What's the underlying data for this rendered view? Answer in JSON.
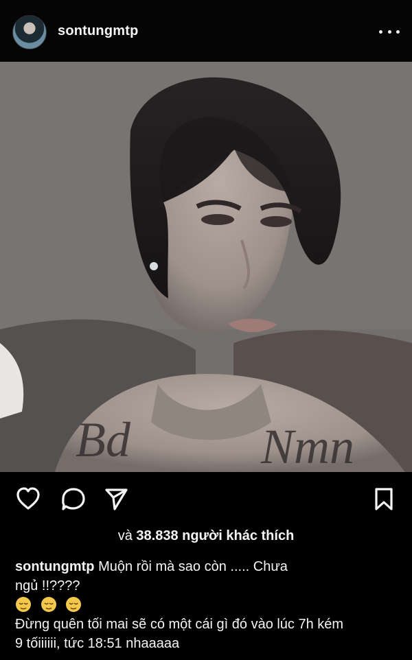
{
  "profile": {
    "username": "sontungmtp",
    "more_icon": "more-options-icon"
  },
  "post": {
    "image_description_icon": "selfie-photo",
    "likes": {
      "prefix": "và",
      "count": "38.838",
      "suffix": "người khác thích"
    },
    "caption": {
      "username": "sontungmtp",
      "line1": "Muộn rồi mà sao còn ..... Chưa",
      "line2": "ngủ !!????",
      "line4": "Đừng quên tối mai sẽ có một cái gì đó vào lúc 7h kém",
      "line5": "9 tốiiiiii, tức 18:51 nhaaaaa"
    }
  },
  "icons": {
    "like": "heart-icon",
    "comment": "comment-icon",
    "share": "send-icon",
    "save": "bookmark-icon",
    "emoji": "relieved-face-icon"
  },
  "colors": {
    "background": "#000000",
    "text": "#f5f5f5"
  }
}
